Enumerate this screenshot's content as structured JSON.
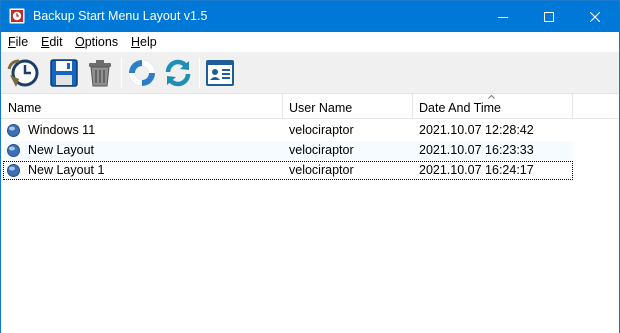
{
  "window": {
    "title": "Backup Start Menu Layout v1.5"
  },
  "menu": {
    "items": [
      {
        "label": "File",
        "accel": "F",
        "rest": "ile"
      },
      {
        "label": "Edit",
        "accel": "E",
        "rest": "dit"
      },
      {
        "label": "Options",
        "accel": "O",
        "rest": "ptions"
      },
      {
        "label": "Help",
        "accel": "H",
        "rest": "elp"
      }
    ]
  },
  "toolbar": {
    "buttons": [
      {
        "name": "backup-restore-icon"
      },
      {
        "name": "save-icon"
      },
      {
        "name": "delete-icon"
      },
      {
        "name": "lifebuoy-icon"
      },
      {
        "name": "refresh-icon"
      },
      {
        "name": "about-card-icon"
      }
    ]
  },
  "list": {
    "columns": [
      "Name",
      "User Name",
      "Date And Time"
    ],
    "sorted_column": "Date And Time",
    "rows": [
      {
        "name": "Windows 11",
        "user": "velociraptor",
        "datetime": "2021.10.07 12:28:42"
      },
      {
        "name": "New Layout",
        "user": "velociraptor",
        "datetime": "2021.10.07 16:23:33"
      },
      {
        "name": "New Layout 1",
        "user": "velociraptor",
        "datetime": "2021.10.07 16:24:17"
      }
    ]
  },
  "colors": {
    "titlebar": "#0078d7",
    "toolbar": "#f0f0f0",
    "hover_row": "#f5fbff"
  }
}
